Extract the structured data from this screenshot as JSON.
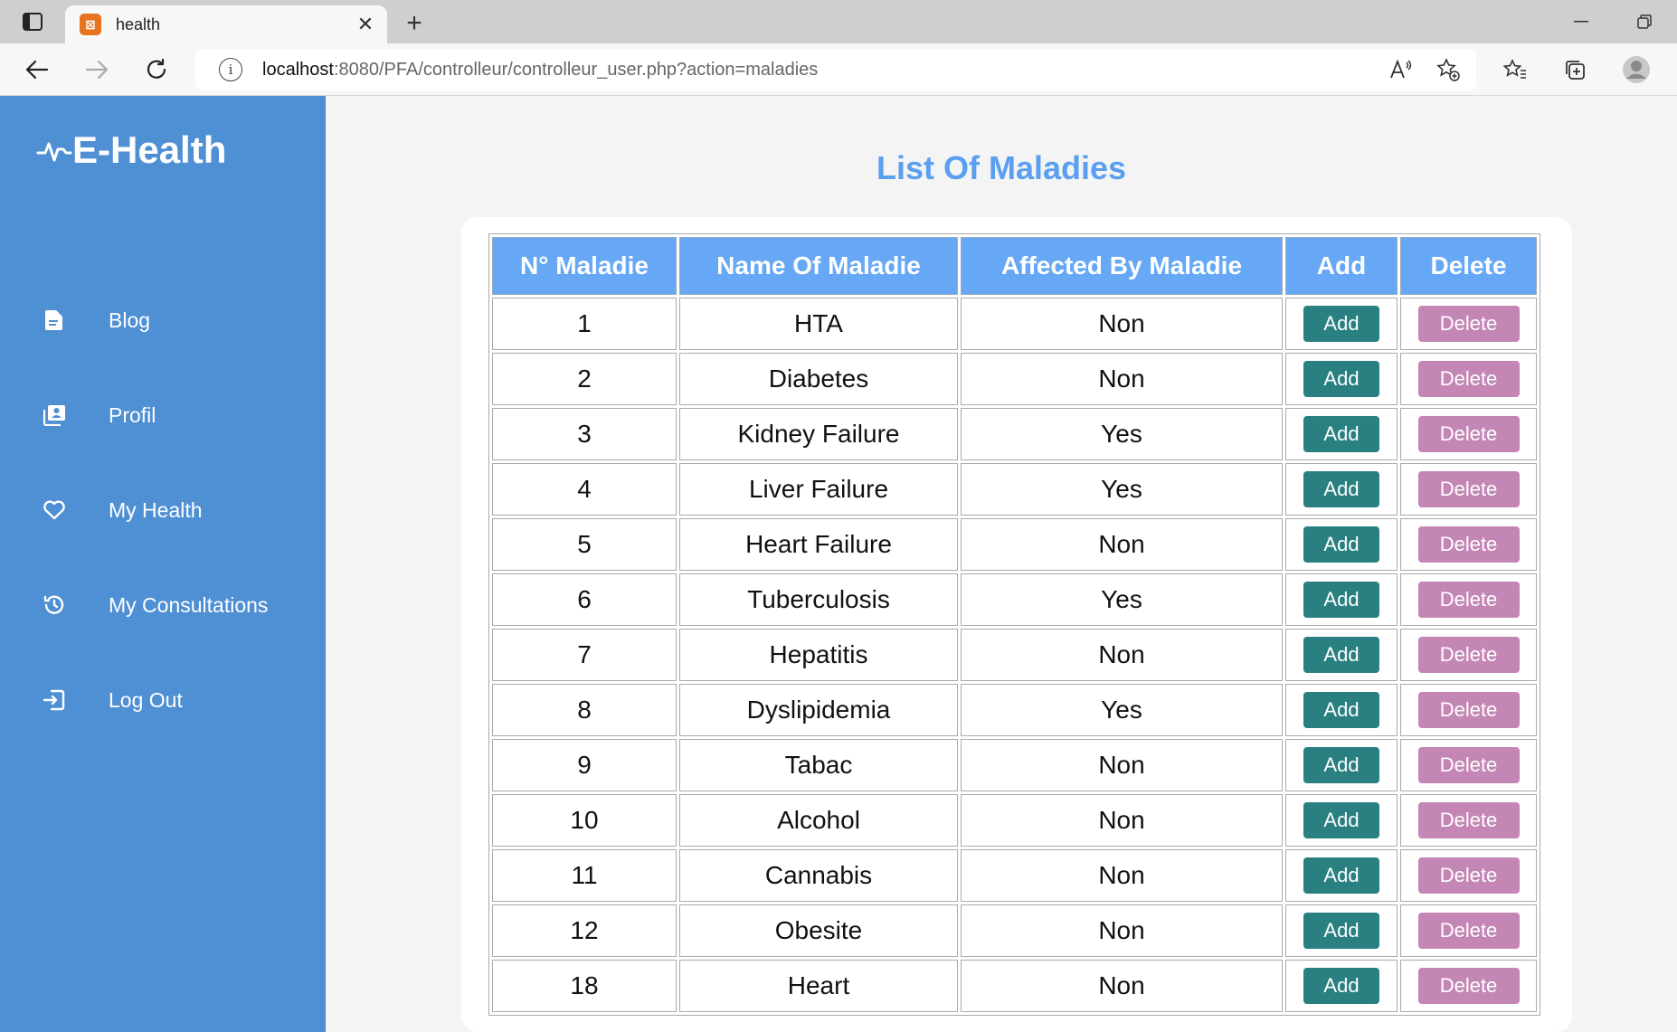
{
  "browser": {
    "tab_title": "health",
    "url_host": "localhost",
    "url_rest": ":8080/PFA/controlleur/controlleur_user.php?action=maladies",
    "favicon": "xampp-icon"
  },
  "sidebar": {
    "logo": "E-Health",
    "items": [
      {
        "label": "Blog",
        "icon": "blog-icon"
      },
      {
        "label": "Profil",
        "icon": "profile-icon"
      },
      {
        "label": "My Health",
        "icon": "heart-icon"
      },
      {
        "label": "My Consultations",
        "icon": "history-icon"
      },
      {
        "label": "Log Out",
        "icon": "logout-icon"
      }
    ]
  },
  "main": {
    "title": "List Of Maladies",
    "columns": [
      "N° Maladie",
      "Name Of Maladie",
      "Affected By Maladie",
      "Add",
      "Delete"
    ],
    "add_label": "Add",
    "delete_label": "Delete",
    "rows": [
      {
        "id": "1",
        "name": "HTA",
        "affected": "Non"
      },
      {
        "id": "2",
        "name": "Diabetes",
        "affected": "Non"
      },
      {
        "id": "3",
        "name": "Kidney Failure",
        "affected": "Yes"
      },
      {
        "id": "4",
        "name": "Liver Failure",
        "affected": "Yes"
      },
      {
        "id": "5",
        "name": "Heart Failure",
        "affected": "Non"
      },
      {
        "id": "6",
        "name": "Tuberculosis",
        "affected": "Yes"
      },
      {
        "id": "7",
        "name": "Hepatitis",
        "affected": "Non"
      },
      {
        "id": "8",
        "name": "Dyslipidemia",
        "affected": "Yes"
      },
      {
        "id": "9",
        "name": "Tabac",
        "affected": "Non"
      },
      {
        "id": "10",
        "name": "Alcohol",
        "affected": "Non"
      },
      {
        "id": "11",
        "name": "Cannabis",
        "affected": "Non"
      },
      {
        "id": "12",
        "name": "Obesite",
        "affected": "Non"
      },
      {
        "id": "18",
        "name": "Heart",
        "affected": "Non"
      }
    ]
  },
  "colors": {
    "sidebar": "#4f8fd4",
    "header": "#66a8f5",
    "title": "#5a9ff0",
    "add_button": "#2a8080",
    "delete_button": "#c486b5"
  }
}
